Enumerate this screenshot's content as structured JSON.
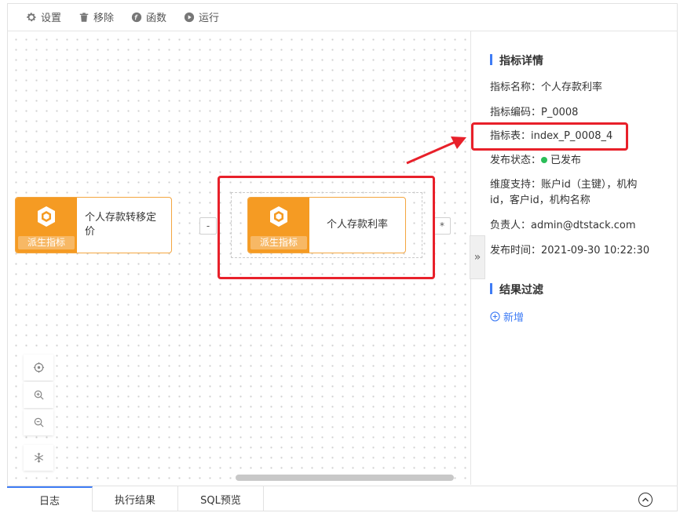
{
  "toolbar": {
    "settings": "设置",
    "remove": "移除",
    "functions": "函数",
    "run": "运行"
  },
  "canvas": {
    "node_left": {
      "badge": "派生指标",
      "text": "个人存款转移定价"
    },
    "node_center": {
      "badge": "派生指标",
      "text": "个人存款利率"
    },
    "connector_left": "-",
    "connector_right": "*"
  },
  "panel": {
    "details_title": "指标详情",
    "name_label": "指标名称：",
    "name_value": "个人存款利率",
    "code_label": "指标编码：",
    "code_value": "P_0008",
    "table_label": "指标表：",
    "table_value": "index_P_0008_4",
    "status_label": "发布状态：",
    "status_value": "已发布",
    "dims_label": "维度支持：",
    "dims_value": "账户id（主键），机构id，客户id，机构名称",
    "owner_label": "负责人：",
    "owner_value": "admin@dtstack.com",
    "time_label": "发布时间：",
    "time_value": "2021-09-30 10:22:30",
    "filter_title": "结果过滤",
    "add_label": "新增",
    "collapse": "»"
  },
  "bottom_tabs": [
    "日志",
    "执行结果",
    "SQL预览"
  ],
  "colors": {
    "accent": "#3f7cf5",
    "node_orange": "#f59b23",
    "annotation_red": "#e8202a",
    "status_green": "#2bbd58"
  }
}
